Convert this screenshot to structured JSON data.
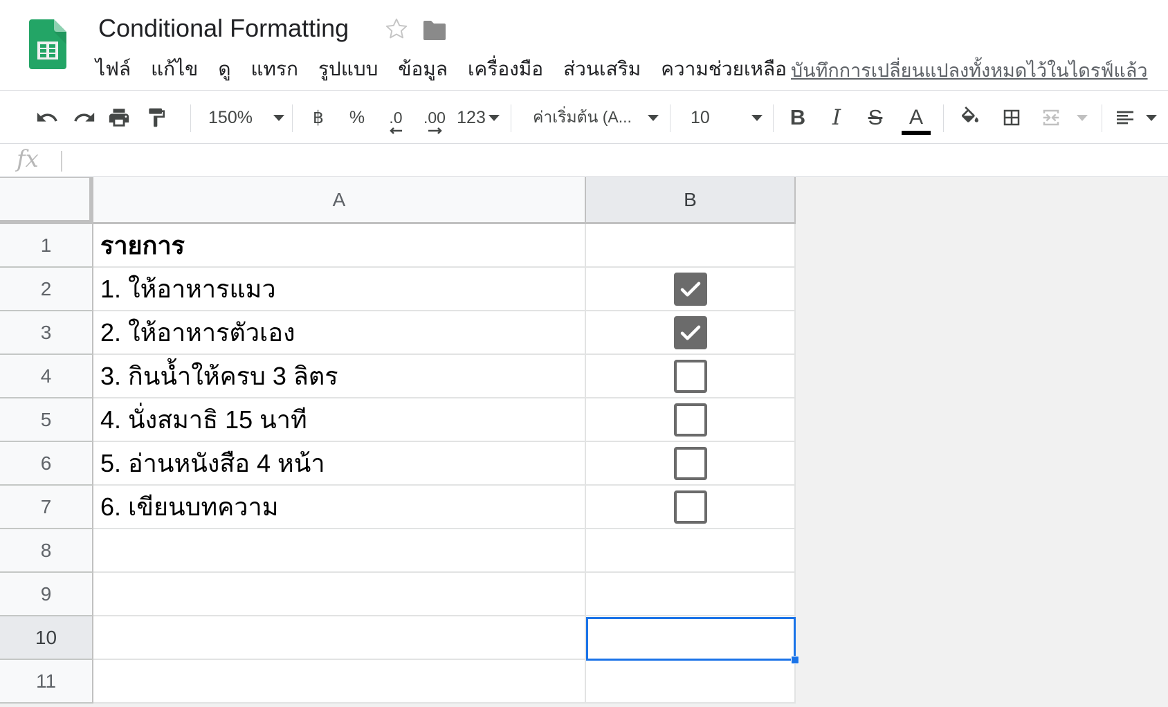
{
  "document": {
    "title": "Conditional Formatting",
    "save_status": "บันทึกการเปลี่ยนแปลงทั้งหมดไว้ในไดรฟ์แล้ว"
  },
  "menu": [
    "ไฟล์",
    "แก้ไข",
    "ดู",
    "แทรก",
    "รูปแบบ",
    "ข้อมูล",
    "เครื่องมือ",
    "ส่วนเสริม",
    "ความช่วยเหลือ"
  ],
  "toolbar": {
    "zoom": "150%",
    "currency": "฿",
    "percent": "%",
    "decrease_decimal": ".0",
    "increase_decimal": ".00",
    "number_format": "123",
    "font": "ค่าเริ่มต้น (A...",
    "font_size": "10",
    "bold": "B",
    "italic": "I",
    "strikethrough": "S",
    "text_color": "A",
    "text_color_value": "#000000"
  },
  "formula_bar": {
    "label": "fx",
    "value": ""
  },
  "columns": [
    "A",
    "B"
  ],
  "rows": [
    {
      "num": "1",
      "a": "รายการ",
      "bold": true,
      "checkbox": null
    },
    {
      "num": "2",
      "a": "1. ให้อาหารแมว",
      "bold": false,
      "checkbox": true
    },
    {
      "num": "3",
      "a": "2. ให้อาหารตัวเอง",
      "bold": false,
      "checkbox": true
    },
    {
      "num": "4",
      "a": "3. กินน้ำให้ครบ 3 ลิตร",
      "bold": false,
      "checkbox": false
    },
    {
      "num": "5",
      "a": "4. นั่งสมาธิ 15 นาที",
      "bold": false,
      "checkbox": false
    },
    {
      "num": "6",
      "a": "5. อ่านหนังสือ 4 หน้า",
      "bold": false,
      "checkbox": false
    },
    {
      "num": "7",
      "a": "6. เขียนบทความ",
      "bold": false,
      "checkbox": false
    },
    {
      "num": "8",
      "a": "",
      "bold": false,
      "checkbox": null
    },
    {
      "num": "9",
      "a": "",
      "bold": false,
      "checkbox": null
    },
    {
      "num": "10",
      "a": "",
      "bold": false,
      "checkbox": null
    },
    {
      "num": "11",
      "a": "",
      "bold": false,
      "checkbox": null
    }
  ],
  "selected_cell": "B10",
  "colors": {
    "accent": "#1a73e8",
    "sheets_green": "#0f9d58",
    "checkbox_gray": "#6b6b6b"
  }
}
